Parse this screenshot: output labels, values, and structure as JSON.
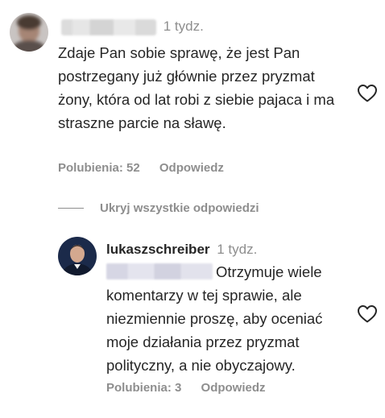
{
  "comment": {
    "time": "1 tydz.",
    "text": "Zdaje Pan sobie sprawę, że jest Pan postrzegany już głównie przez pryzmat żony, która od lat robi z siebie pajaca i ma straszne parcie na sławę.",
    "likes": "Polubienia: 52",
    "reply": "Odpowiedz"
  },
  "toggle_replies": "Ukryj wszystkie odpowiedzi",
  "reply": {
    "username": "lukaszschreiber",
    "time": "1 tydz.",
    "text": "Otrzymuje wiele komentarzy w tej sprawie, ale niezmiennie proszę, aby oceniać moje działania przez pryzmat polityczny, a nie obyczajowy.",
    "likes": "Polubienia: 3",
    "reply": "Odpowiedz"
  },
  "icons": {
    "like": "heart-outline-icon"
  },
  "colors": {
    "text": "#262626",
    "secondary": "#8e8e8e",
    "avatar_navy": "#1b2a4a"
  }
}
